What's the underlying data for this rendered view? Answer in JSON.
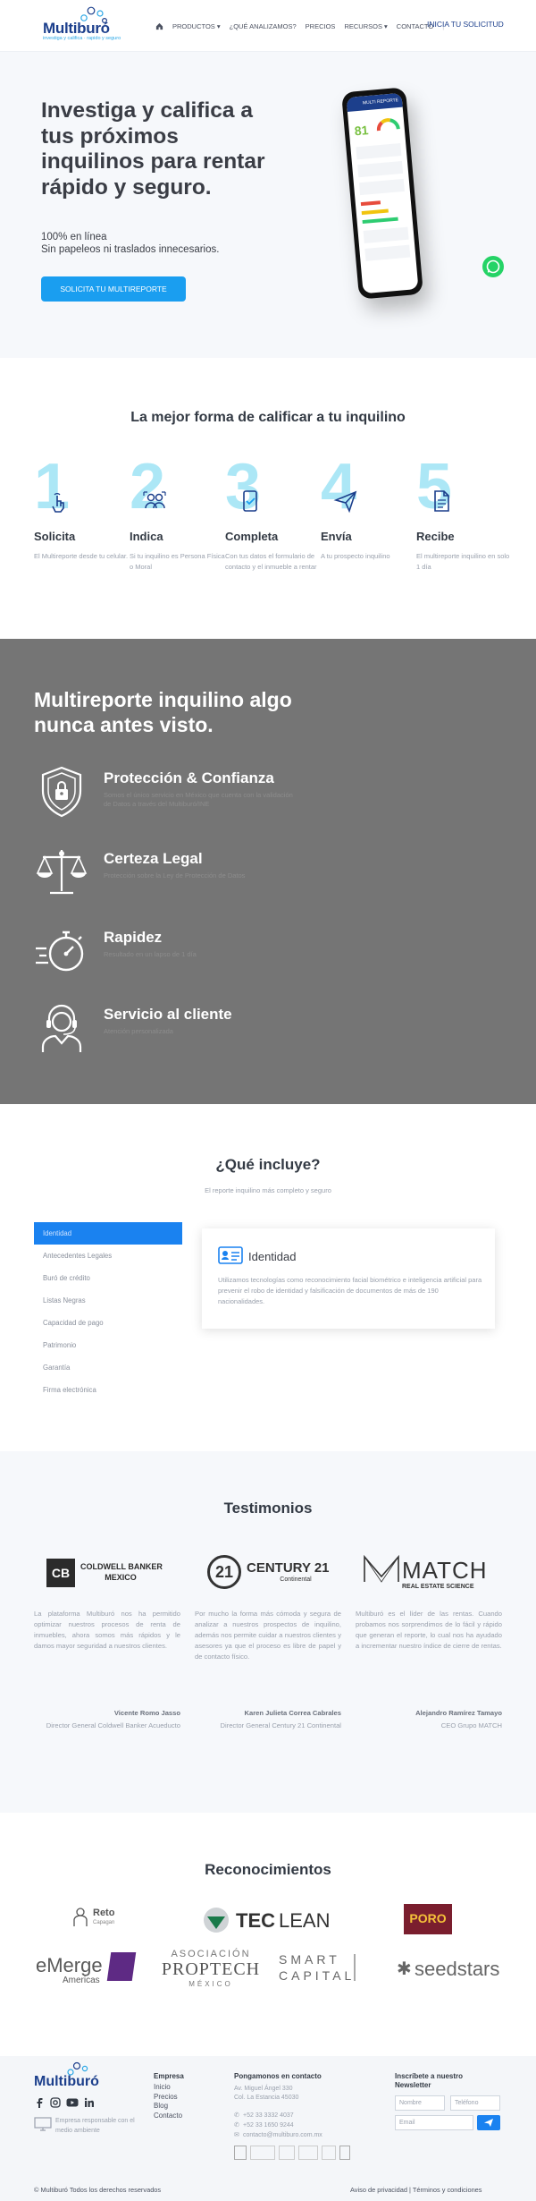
{
  "brand": {
    "name": "Multiburó",
    "tagline": "investiga y califica · rapido y seguro"
  },
  "nav": {
    "items": [
      "PRODUCTOS ▾",
      "¿QUÉ ANALIZAMOS?",
      "PRECIOS",
      "RECURSOS ▾",
      "CONTACTO"
    ],
    "cta": "INICIA TU SOLICITUD"
  },
  "hero": {
    "title": "Investiga y califica a tus próximos inquilinos para rentar rápido y seguro.",
    "subtitle_1": "100% en línea",
    "subtitle_2": "Sin papeleos ni traslados innecesarios.",
    "button": "SOLICITA TU MULTIREPORTE",
    "phone_header": "MULTI REPORTE",
    "phone_score": "81"
  },
  "steps": {
    "title": "La mejor forma de calificar a tu inquilino",
    "items": [
      {
        "num": "1",
        "name": "Solicita",
        "desc": "El Multireporte desde tu celular.",
        "icon": "hand-tap-icon"
      },
      {
        "num": "2",
        "name": "Indica",
        "desc": "Si tu inquilino es Persona Física o Moral",
        "icon": "people-icon"
      },
      {
        "num": "3",
        "name": "Completa",
        "desc": "Con tus datos el formulario de contacto y el inmueble a rentar",
        "icon": "phone-check-icon"
      },
      {
        "num": "4",
        "name": "Envía",
        "desc": "A tu prospecto inquilino",
        "icon": "send-icon"
      },
      {
        "num": "5",
        "name": "Recibe",
        "desc": "El multireporte inquilino en solo 1 día",
        "icon": "document-icon"
      }
    ]
  },
  "features": {
    "title": "Multireporte inquilino algo nunca antes visto.",
    "items": [
      {
        "title": "Protección & Confianza",
        "desc": "Somos el único servicio en México que cuenta con la validación de Datos a través del Multiburó/INE",
        "icon": "shield-lock-icon"
      },
      {
        "title": "Certeza Legal",
        "desc": "Protección sobre la Ley de Protección de Datos",
        "icon": "scales-icon"
      },
      {
        "title": "Rapidez",
        "desc": "Resultado en un lapso de 1 día",
        "icon": "stopwatch-icon"
      },
      {
        "title": "Servicio al cliente",
        "desc": "Atención personalizada",
        "icon": "headset-agent-icon"
      }
    ]
  },
  "includes": {
    "title": "¿Qué incluye?",
    "subtitle": "El reporte inquilino más completo y seguro",
    "list": [
      "Identidad",
      "Antecedentes Legales",
      "Buró de crédito",
      "Listas Negras",
      "Capacidad de pago",
      "Patrimonio",
      "Garantía",
      "Firma electrónica"
    ],
    "active_index": 0,
    "card_title": "Identidad",
    "card_desc": "Utilizamos tecnologías como reconocimiento facial biométrico e inteligencia artificial para prevenir el robo de identidad y falsificación de documentos de más de 190 nacionalidades."
  },
  "testimonials": {
    "title": "Testimonios",
    "items": [
      {
        "logo_line1": "COLDWELL BANKER",
        "logo_line2": "MEXICO",
        "text": "La plataforma Multiburó nos ha permitido optimizar nuestros procesos de renta de inmuebles, ahora somos más rápidos y le damos mayor seguridad a nuestros clientes.",
        "name": "Vicente Romo Jasso",
        "role": "Director General Coldwell Banker Acueducto"
      },
      {
        "logo_line1": "CENTURY 21",
        "logo_line2": "Continental",
        "text": "Por mucho la forma más cómoda y segura de analizar a nuestros prospectos de inquilino, además nos permite cuidar a nuestros clientes y asesores ya que el proceso es libre de papel y de contacto físico.",
        "name": "Karen Julieta Correa Cabrales",
        "role": "Director General Century 21 Continental"
      },
      {
        "logo_line1": "MATCH",
        "logo_line2": "REAL ESTATE SCIENCE",
        "text": "Multiburó es el líder de las rentas. Cuando probamos nos sorprendimos de lo fácil y rápido que generan el reporte, lo cual nos ha ayudado a incrementar nuestro índice de cierre de rentas.",
        "name": "Alejandro Ramírez Tamayo",
        "role": "CEO Grupo MATCH"
      }
    ]
  },
  "recognitions": {
    "title": "Reconocimientos",
    "logos": {
      "reto": "Reto",
      "reto_sub": "Capagan",
      "teclean_a": "TEC",
      "teclean_b": "LEAN",
      "poro": "PORO",
      "emerge": "eMerge",
      "emerge_sub": "Americas",
      "proptech_1": "ASOCIACIÓN",
      "proptech_2": "PROPTECH",
      "proptech_3": "MÉXICO",
      "smart_1": "SMART",
      "smart_2": "CAPITAL",
      "seedstars": "seedstars"
    }
  },
  "footer": {
    "brand": "Multiburó",
    "eco_text": "Empresa responsable con el medio ambiente",
    "empresa_title": "Empresa",
    "empresa_links": [
      "Inicio",
      "Precios",
      "Blog",
      "Contacto"
    ],
    "contact_title": "Pongamonos en contacto",
    "address_1": "Av. Miguel Ángel 330",
    "address_2": "Col. La Estancia 45030",
    "phone_1": "+52 33 3332 4037",
    "phone_2": "+52 33 1650 9244",
    "email": "contacto@multiburo.com.mx",
    "newsletter_title": "Inscríbete a nuestro Newsletter",
    "placeholder_name": "Nombre",
    "placeholder_phone": "Teléfono",
    "placeholder_email": "Email",
    "copyright": "© Multiburó Todos los derechos reservados",
    "legal": "Aviso de privacidad | Términos y condiciones"
  },
  "colors": {
    "primary": "#1a9ef0",
    "navy": "#1c3f8c",
    "dark_section": "#757575",
    "step_numbers": "#9ee3f5"
  }
}
